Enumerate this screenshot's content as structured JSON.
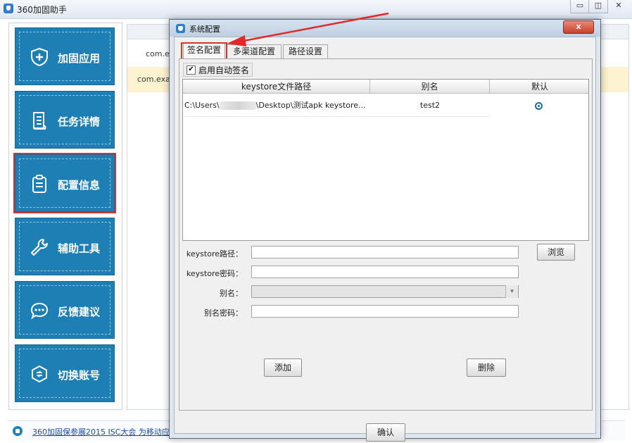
{
  "window": {
    "title": "360加固助手",
    "controls": [
      "▭",
      "◫",
      "✕"
    ]
  },
  "sidebar": {
    "items": [
      {
        "label": "加固应用",
        "icon": "shield-plus-icon"
      },
      {
        "label": "任务详情",
        "icon": "document-list-icon"
      },
      {
        "label": "配置信息",
        "icon": "clipboard-icon",
        "active": true
      },
      {
        "label": "辅助工具",
        "icon": "wrench-icon"
      },
      {
        "label": "反馈建议",
        "icon": "chat-bubble-icon"
      },
      {
        "label": "切换账号",
        "icon": "switch-account-icon"
      }
    ]
  },
  "content": {
    "rows": [
      "com.ex",
      "com.exa"
    ]
  },
  "statusbar": {
    "text": "360加固保参展2015 ISC大会 为移动应"
  },
  "dialog": {
    "title": "系统配置",
    "close_label": "x",
    "tabs": [
      "签名配置",
      "多渠道配置",
      "路径设置"
    ],
    "active_tab": 0,
    "auto_sign": {
      "label": "启用自动签名",
      "checked": true
    },
    "table": {
      "headers": [
        "keystore文件路径",
        "别名",
        "默认"
      ],
      "rows": [
        {
          "path_prefix": "C:\\Users\\",
          "path_suffix": "\\Desktop\\测试apk keystore...",
          "alias": "test2",
          "default": true
        }
      ]
    },
    "form": {
      "keystore_path_label": "keystore路径：",
      "keystore_password_label": "keystore密码：",
      "alias_label": "别名：",
      "alias_password_label": "别名密码："
    },
    "buttons": {
      "browse": "浏览",
      "add": "添加",
      "delete": "删除",
      "confirm": "确认"
    }
  },
  "colors": {
    "sidebar_button": "#1e7fb5",
    "highlight": "#d9342b",
    "selected_row": "#fdf3d0"
  }
}
